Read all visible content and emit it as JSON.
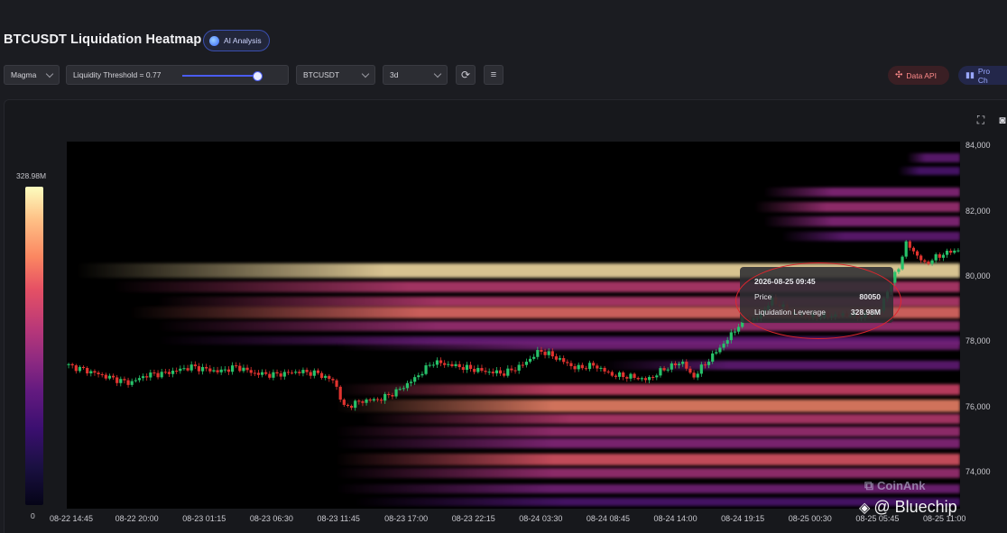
{
  "header": {
    "title": "BTCUSDT Liquidation Heatmap",
    "ai_button": "AI Analysis"
  },
  "toolbar": {
    "colormap": "Magma",
    "threshold_label": "Liquidity Threshold = 0.77",
    "threshold_value": 0.77,
    "symbol": "BTCUSDT",
    "range": "3d",
    "data_api": "Data API",
    "pro_chart": "Pro Ch"
  },
  "colorbar": {
    "max_label": "328.98M",
    "min_label": "0"
  },
  "tooltip": {
    "time": "2026-08-25 09:45",
    "price_label": "Price",
    "price_value": "80050",
    "lev_label": "Liquidation Leverage",
    "lev_value": "328.98M"
  },
  "watermark": {
    "coinank": "CoinAnk",
    "bluechip": "@ Bluechip"
  },
  "colors": {
    "candle_up": "#27c26a",
    "candle_down": "#e2332f",
    "annotation": "#e0262e"
  },
  "chart_data": {
    "type": "heatmap",
    "title": "BTCUSDT Liquidation Heatmap",
    "y_ticks": [
      84000,
      82000,
      80000,
      78000,
      76000,
      74000
    ],
    "y_tick_labels": [
      "84,000",
      "82,000",
      "80,000",
      "78,000",
      "76,000",
      "74,000"
    ],
    "ylim": [
      72900,
      84150
    ],
    "x_tick_labels": [
      "08-22 14:45",
      "08-22 20:00",
      "08-23 01:15",
      "08-23 06:30",
      "08-23 11:45",
      "08-23 17:00",
      "08-23 22:15",
      "08-24 03:30",
      "08-24 08:45",
      "08-24 14:00",
      "08-24 19:15",
      "08-25 00:30",
      "08-25 05:45",
      "08-25 11:00"
    ],
    "colorscale": "Magma",
    "colorbar_range": [
      0,
      "328.98M"
    ],
    "liquidation_bands": [
      {
        "price": 83650,
        "start": 0.94,
        "intensity": 0.35
      },
      {
        "price": 83250,
        "start": 0.93,
        "intensity": 0.3
      },
      {
        "price": 82600,
        "start": 0.78,
        "intensity": 0.45
      },
      {
        "price": 82150,
        "start": 0.77,
        "intensity": 0.5
      },
      {
        "price": 81700,
        "start": 0.78,
        "intensity": 0.45
      },
      {
        "price": 81250,
        "start": 0.8,
        "intensity": 0.35
      },
      {
        "price": 80200,
        "start": 0.01,
        "intensity": 0.95
      },
      {
        "price": 79700,
        "start": 0.05,
        "intensity": 0.55
      },
      {
        "price": 79250,
        "start": 0.1,
        "intensity": 0.55
      },
      {
        "price": 78900,
        "start": 0.07,
        "intensity": 0.7
      },
      {
        "price": 78500,
        "start": 0.1,
        "intensity": 0.5
      },
      {
        "price": 78050,
        "start": 0.1,
        "intensity": 0.35
      },
      {
        "price": 77900,
        "start": 0.3,
        "intensity": 0.4
      },
      {
        "price": 77300,
        "start": 0.6,
        "intensity": 0.35
      },
      {
        "price": 76550,
        "start": 0.3,
        "intensity": 0.6
      },
      {
        "price": 76050,
        "start": 0.3,
        "intensity": 0.75
      },
      {
        "price": 75650,
        "start": 0.33,
        "intensity": 0.55
      },
      {
        "price": 75250,
        "start": 0.3,
        "intensity": 0.5
      },
      {
        "price": 74900,
        "start": 0.3,
        "intensity": 0.45
      },
      {
        "price": 74400,
        "start": 0.3,
        "intensity": 0.65
      },
      {
        "price": 74000,
        "start": 0.3,
        "intensity": 0.5
      },
      {
        "price": 73500,
        "start": 0.3,
        "intensity": 0.4
      },
      {
        "price": 73100,
        "start": 0.32,
        "intensity": 0.3
      }
    ],
    "price_path": [
      [
        0,
        77300
      ],
      [
        0.02,
        77150
      ],
      [
        0.05,
        76900
      ],
      [
        0.07,
        76750
      ],
      [
        0.09,
        77000
      ],
      [
        0.11,
        77050
      ],
      [
        0.14,
        77250
      ],
      [
        0.17,
        77100
      ],
      [
        0.19,
        77250
      ],
      [
        0.21,
        77050
      ],
      [
        0.23,
        77000
      ],
      [
        0.26,
        77100
      ],
      [
        0.28,
        77050
      ],
      [
        0.3,
        76800
      ],
      [
        0.31,
        76000
      ],
      [
        0.33,
        76200
      ],
      [
        0.35,
        76250
      ],
      [
        0.37,
        76500
      ],
      [
        0.39,
        76900
      ],
      [
        0.41,
        77400
      ],
      [
        0.43,
        77300
      ],
      [
        0.45,
        77200
      ],
      [
        0.47,
        77100
      ],
      [
        0.49,
        77050
      ],
      [
        0.51,
        77300
      ],
      [
        0.53,
        77750
      ],
      [
        0.55,
        77500
      ],
      [
        0.57,
        77200
      ],
      [
        0.59,
        77300
      ],
      [
        0.61,
        77000
      ],
      [
        0.63,
        76950
      ],
      [
        0.65,
        76850
      ],
      [
        0.67,
        77200
      ],
      [
        0.69,
        77400
      ],
      [
        0.7,
        76900
      ],
      [
        0.72,
        77500
      ],
      [
        0.74,
        78100
      ],
      [
        0.76,
        78800
      ],
      [
        0.77,
        78650
      ],
      [
        0.79,
        79300
      ],
      [
        0.81,
        78900
      ],
      [
        0.83,
        78800
      ],
      [
        0.85,
        78800
      ],
      [
        0.87,
        78850
      ],
      [
        0.89,
        78800
      ],
      [
        0.91,
        78950
      ],
      [
        0.92,
        79700
      ],
      [
        0.93,
        80200
      ],
      [
        0.94,
        81050
      ],
      [
        0.96,
        80400
      ],
      [
        0.98,
        80700
      ],
      [
        1.0,
        80850
      ]
    ]
  }
}
